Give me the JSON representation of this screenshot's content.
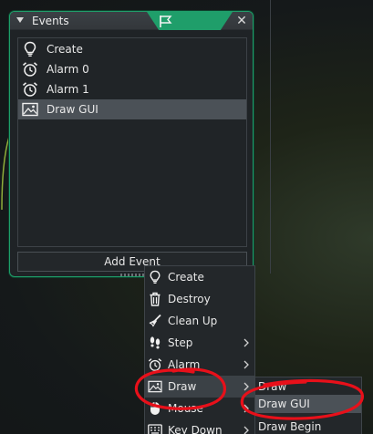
{
  "events_window": {
    "title": "Events",
    "close_glyph": "✕",
    "items": [
      {
        "label": "Create",
        "icon": "lightbulb-icon"
      },
      {
        "label": "Alarm 0",
        "icon": "alarm-clock-icon"
      },
      {
        "label": "Alarm 1",
        "icon": "alarm-clock-icon"
      },
      {
        "label": "Draw GUI",
        "icon": "image-icon",
        "selected": true
      }
    ],
    "add_event_label": "Add Event"
  },
  "context_menu": {
    "items": [
      {
        "label": "Create",
        "icon": "lightbulb-icon",
        "has_submenu": false
      },
      {
        "label": "Destroy",
        "icon": "trash-icon",
        "has_submenu": false
      },
      {
        "label": "Clean Up",
        "icon": "broom-icon",
        "has_submenu": false
      },
      {
        "label": "Step",
        "icon": "footsteps-icon",
        "has_submenu": true
      },
      {
        "label": "Alarm",
        "icon": "alarm-clock-icon",
        "has_submenu": true
      },
      {
        "label": "Draw",
        "icon": "image-icon",
        "has_submenu": true,
        "highlighted": true
      },
      {
        "label": "Mouse",
        "icon": "mouse-icon",
        "has_submenu": true
      },
      {
        "label": "Key Down",
        "icon": "keyboard-icon",
        "has_submenu": true
      }
    ]
  },
  "draw_submenu": {
    "items": [
      {
        "label": "Draw"
      },
      {
        "label": "Draw GUI",
        "selected": true
      },
      {
        "label": "Draw Begin"
      }
    ]
  },
  "colors": {
    "accent_green": "#1f9e6a",
    "annotation_red": "#e8101a",
    "selection": "#4b5157"
  }
}
